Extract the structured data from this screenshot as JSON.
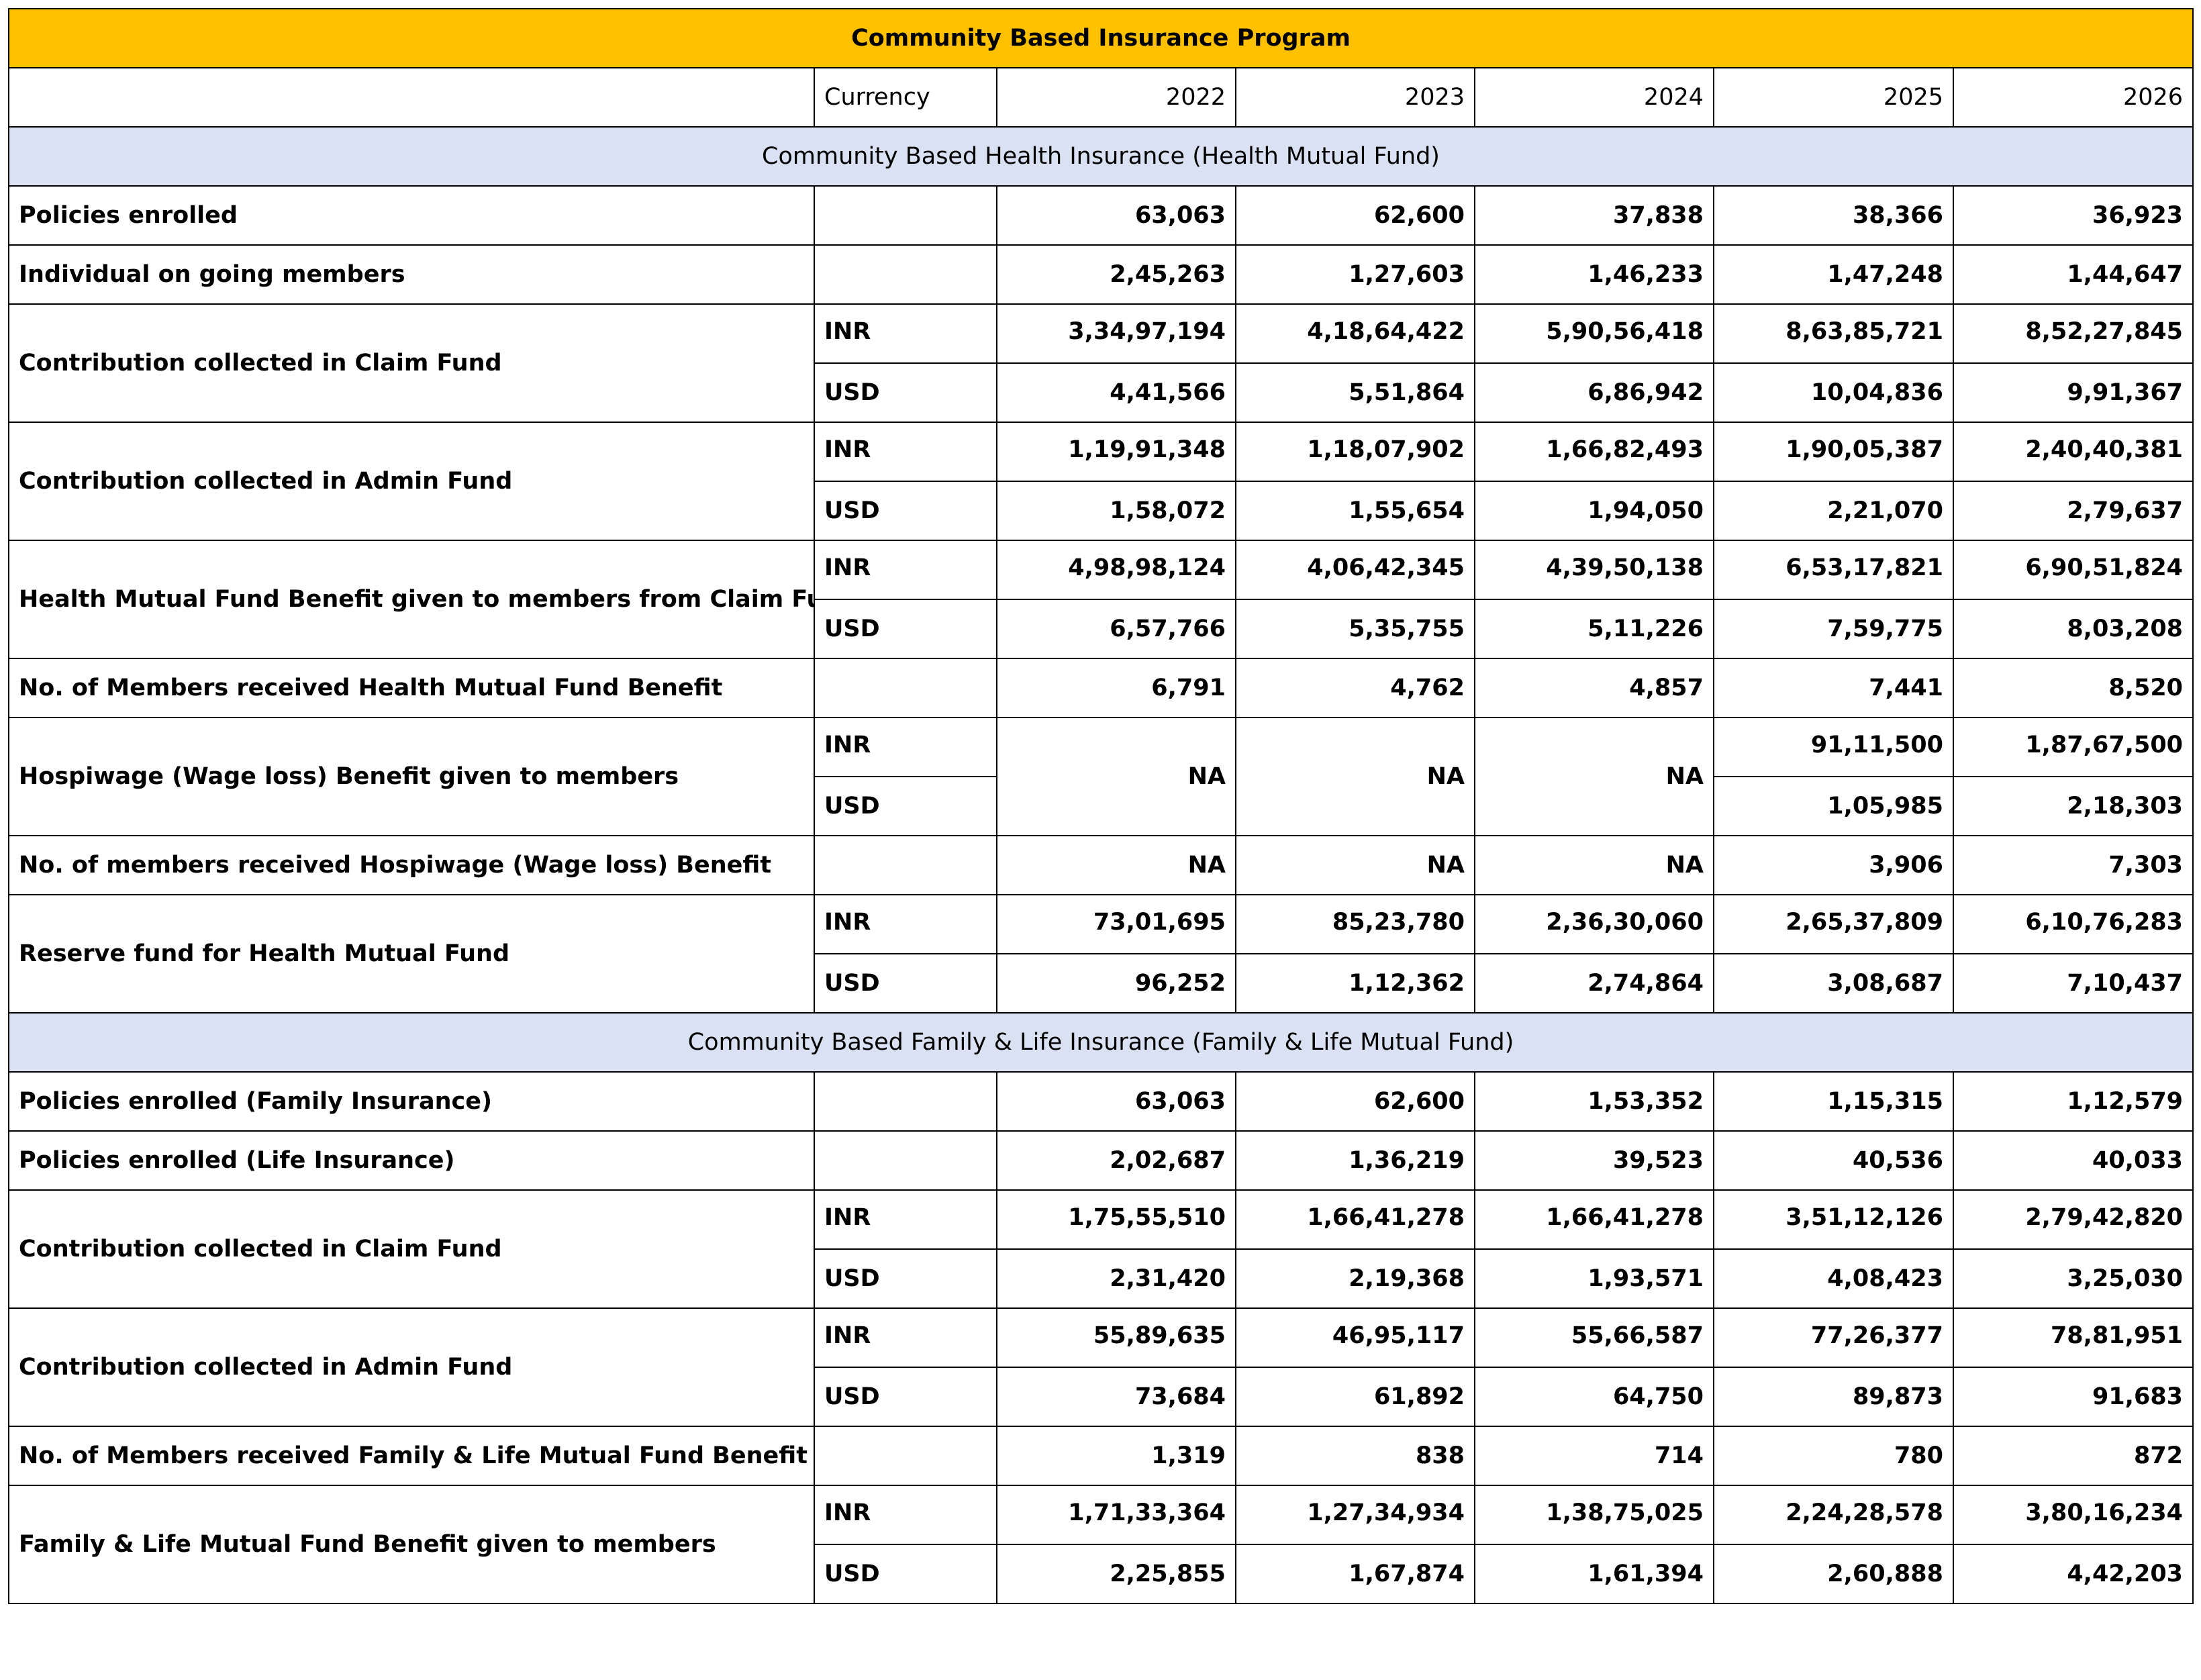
{
  "title": "Community Based Insurance Program",
  "header": {
    "currency_label": "Currency",
    "years": [
      "2022",
      "2023",
      "2024",
      "2025",
      "2026"
    ]
  },
  "sections": [
    {
      "title": "Community Based Health Insurance (Health Mutual Fund)",
      "rows": [
        {
          "label": "Policies enrolled",
          "lines": [
            {
              "currency": "",
              "values": [
                "63,063",
                "62,600",
                "37,838",
                "38,366",
                "36,923"
              ]
            }
          ]
        },
        {
          "label": "Individual on going members",
          "lines": [
            {
              "currency": "",
              "values": [
                "2,45,263",
                "1,27,603",
                "1,46,233",
                "1,47,248",
                "1,44,647"
              ]
            }
          ]
        },
        {
          "label": "Contribution collected in Claim Fund",
          "lines": [
            {
              "currency": "INR",
              "values": [
                "3,34,97,194",
                "4,18,64,422",
                "5,90,56,418",
                "8,63,85,721",
                "8,52,27,845"
              ]
            },
            {
              "currency": "USD",
              "values": [
                "4,41,566",
                "5,51,864",
                "6,86,942",
                "10,04,836",
                "9,91,367"
              ]
            }
          ]
        },
        {
          "label": "Contribution collected in Admin Fund",
          "lines": [
            {
              "currency": "INR",
              "values": [
                "1,19,91,348",
                "1,18,07,902",
                "1,66,82,493",
                "1,90,05,387",
                "2,40,40,381"
              ]
            },
            {
              "currency": "USD",
              "values": [
                "1,58,072",
                "1,55,654",
                "1,94,050",
                "2,21,070",
                "2,79,637"
              ]
            }
          ]
        },
        {
          "label": "Health Mutual Fund Benefit given to members  from Claim Fund",
          "lines": [
            {
              "currency": "INR",
              "values": [
                "4,98,98,124",
                "4,06,42,345",
                "4,39,50,138",
                "6,53,17,821",
                "6,90,51,824"
              ]
            },
            {
              "currency": "USD",
              "values": [
                "6,57,766",
                "5,35,755",
                "5,11,226",
                "7,59,775",
                "8,03,208"
              ]
            }
          ]
        },
        {
          "label": "No. of Members received Health Mutual Fund Benefit",
          "lines": [
            {
              "currency": "",
              "values": [
                "6,791",
                "4,762",
                "4,857",
                "7,441",
                "8,520"
              ]
            }
          ]
        },
        {
          "label": "Hospiwage (Wage loss) Benefit given to members",
          "merged": [
            "NA",
            "NA",
            "NA"
          ],
          "lines": [
            {
              "currency": "INR",
              "values": [
                "91,11,500",
                "1,87,67,500"
              ]
            },
            {
              "currency": "USD",
              "values": [
                "1,05,985",
                "2,18,303"
              ]
            }
          ]
        },
        {
          "label": "No. of members received Hospiwage (Wage loss) Benefit",
          "lines": [
            {
              "currency": "",
              "values": [
                "NA",
                "NA",
                "NA",
                "3,906",
                "7,303"
              ]
            }
          ]
        },
        {
          "label": "Reserve fund for Health Mutual Fund",
          "lines": [
            {
              "currency": "INR",
              "values": [
                "73,01,695",
                "85,23,780",
                "2,36,30,060",
                "2,65,37,809",
                "6,10,76,283"
              ]
            },
            {
              "currency": "USD",
              "values": [
                "96,252",
                "1,12,362",
                "2,74,864",
                "3,08,687",
                "7,10,437"
              ]
            }
          ]
        }
      ]
    },
    {
      "title": "Community Based Family & Life Insurance (Family & Life Mutual Fund)",
      "rows": [
        {
          "label": "Policies enrolled (Family Insurance)",
          "lines": [
            {
              "currency": "",
              "values": [
                "63,063",
                "62,600",
                "1,53,352",
                "1,15,315",
                "1,12,579"
              ]
            }
          ]
        },
        {
          "label": "Policies enrolled (Life Insurance)",
          "lines": [
            {
              "currency": "",
              "values": [
                "2,02,687",
                "1,36,219",
                "39,523",
                "40,536",
                "40,033"
              ]
            }
          ]
        },
        {
          "label": "Contribution collected in Claim Fund",
          "lines": [
            {
              "currency": "INR",
              "values": [
                "1,75,55,510",
                "1,66,41,278",
                "1,66,41,278",
                "3,51,12,126",
                "2,79,42,820"
              ]
            },
            {
              "currency": "USD",
              "values": [
                "2,31,420",
                "2,19,368",
                "1,93,571",
                "4,08,423",
                "3,25,030"
              ]
            }
          ]
        },
        {
          "label": "Contribution collected in Admin Fund",
          "lines": [
            {
              "currency": "INR",
              "values": [
                "55,89,635",
                "46,95,117",
                "55,66,587",
                "77,26,377",
                "78,81,951"
              ]
            },
            {
              "currency": "USD",
              "values": [
                "73,684",
                "61,892",
                "64,750",
                "89,873",
                "91,683"
              ]
            }
          ]
        },
        {
          "label": "No. of Members received Family & Life Mutual Fund Benefit",
          "lines": [
            {
              "currency": "",
              "values": [
                "1,319",
                "838",
                "714",
                "780",
                "872"
              ]
            }
          ]
        },
        {
          "label": "Family & Life Mutual Fund Benefit given to members",
          "lines": [
            {
              "currency": "INR",
              "values": [
                "1,71,33,364",
                "1,27,34,934",
                "1,38,75,025",
                "2,24,28,578",
                "3,80,16,234"
              ]
            },
            {
              "currency": "USD",
              "values": [
                "2,25,855",
                "1,67,874",
                "1,61,394",
                "2,60,888",
                "4,42,203"
              ]
            }
          ]
        }
      ]
    }
  ]
}
